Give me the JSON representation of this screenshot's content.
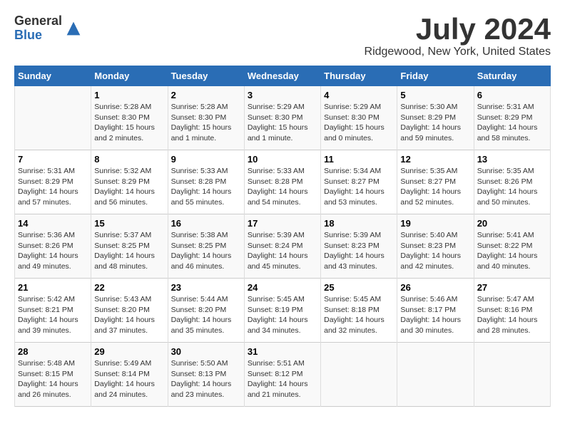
{
  "header": {
    "logo": {
      "general": "General",
      "blue": "Blue"
    },
    "title": "July 2024",
    "location": "Ridgewood, New York, United States"
  },
  "calendar": {
    "days_of_week": [
      "Sunday",
      "Monday",
      "Tuesday",
      "Wednesday",
      "Thursday",
      "Friday",
      "Saturday"
    ],
    "weeks": [
      [
        {
          "day": "",
          "info": ""
        },
        {
          "day": "1",
          "info": "Sunrise: 5:28 AM\nSunset: 8:30 PM\nDaylight: 15 hours\nand 2 minutes."
        },
        {
          "day": "2",
          "info": "Sunrise: 5:28 AM\nSunset: 8:30 PM\nDaylight: 15 hours\nand 1 minute."
        },
        {
          "day": "3",
          "info": "Sunrise: 5:29 AM\nSunset: 8:30 PM\nDaylight: 15 hours\nand 1 minute."
        },
        {
          "day": "4",
          "info": "Sunrise: 5:29 AM\nSunset: 8:30 PM\nDaylight: 15 hours\nand 0 minutes."
        },
        {
          "day": "5",
          "info": "Sunrise: 5:30 AM\nSunset: 8:29 PM\nDaylight: 14 hours\nand 59 minutes."
        },
        {
          "day": "6",
          "info": "Sunrise: 5:31 AM\nSunset: 8:29 PM\nDaylight: 14 hours\nand 58 minutes."
        }
      ],
      [
        {
          "day": "7",
          "info": "Sunrise: 5:31 AM\nSunset: 8:29 PM\nDaylight: 14 hours\nand 57 minutes."
        },
        {
          "day": "8",
          "info": "Sunrise: 5:32 AM\nSunset: 8:29 PM\nDaylight: 14 hours\nand 56 minutes."
        },
        {
          "day": "9",
          "info": "Sunrise: 5:33 AM\nSunset: 8:28 PM\nDaylight: 14 hours\nand 55 minutes."
        },
        {
          "day": "10",
          "info": "Sunrise: 5:33 AM\nSunset: 8:28 PM\nDaylight: 14 hours\nand 54 minutes."
        },
        {
          "day": "11",
          "info": "Sunrise: 5:34 AM\nSunset: 8:27 PM\nDaylight: 14 hours\nand 53 minutes."
        },
        {
          "day": "12",
          "info": "Sunrise: 5:35 AM\nSunset: 8:27 PM\nDaylight: 14 hours\nand 52 minutes."
        },
        {
          "day": "13",
          "info": "Sunrise: 5:35 AM\nSunset: 8:26 PM\nDaylight: 14 hours\nand 50 minutes."
        }
      ],
      [
        {
          "day": "14",
          "info": "Sunrise: 5:36 AM\nSunset: 8:26 PM\nDaylight: 14 hours\nand 49 minutes."
        },
        {
          "day": "15",
          "info": "Sunrise: 5:37 AM\nSunset: 8:25 PM\nDaylight: 14 hours\nand 48 minutes."
        },
        {
          "day": "16",
          "info": "Sunrise: 5:38 AM\nSunset: 8:25 PM\nDaylight: 14 hours\nand 46 minutes."
        },
        {
          "day": "17",
          "info": "Sunrise: 5:39 AM\nSunset: 8:24 PM\nDaylight: 14 hours\nand 45 minutes."
        },
        {
          "day": "18",
          "info": "Sunrise: 5:39 AM\nSunset: 8:23 PM\nDaylight: 14 hours\nand 43 minutes."
        },
        {
          "day": "19",
          "info": "Sunrise: 5:40 AM\nSunset: 8:23 PM\nDaylight: 14 hours\nand 42 minutes."
        },
        {
          "day": "20",
          "info": "Sunrise: 5:41 AM\nSunset: 8:22 PM\nDaylight: 14 hours\nand 40 minutes."
        }
      ],
      [
        {
          "day": "21",
          "info": "Sunrise: 5:42 AM\nSunset: 8:21 PM\nDaylight: 14 hours\nand 39 minutes."
        },
        {
          "day": "22",
          "info": "Sunrise: 5:43 AM\nSunset: 8:20 PM\nDaylight: 14 hours\nand 37 minutes."
        },
        {
          "day": "23",
          "info": "Sunrise: 5:44 AM\nSunset: 8:20 PM\nDaylight: 14 hours\nand 35 minutes."
        },
        {
          "day": "24",
          "info": "Sunrise: 5:45 AM\nSunset: 8:19 PM\nDaylight: 14 hours\nand 34 minutes."
        },
        {
          "day": "25",
          "info": "Sunrise: 5:45 AM\nSunset: 8:18 PM\nDaylight: 14 hours\nand 32 minutes."
        },
        {
          "day": "26",
          "info": "Sunrise: 5:46 AM\nSunset: 8:17 PM\nDaylight: 14 hours\nand 30 minutes."
        },
        {
          "day": "27",
          "info": "Sunrise: 5:47 AM\nSunset: 8:16 PM\nDaylight: 14 hours\nand 28 minutes."
        }
      ],
      [
        {
          "day": "28",
          "info": "Sunrise: 5:48 AM\nSunset: 8:15 PM\nDaylight: 14 hours\nand 26 minutes."
        },
        {
          "day": "29",
          "info": "Sunrise: 5:49 AM\nSunset: 8:14 PM\nDaylight: 14 hours\nand 24 minutes."
        },
        {
          "day": "30",
          "info": "Sunrise: 5:50 AM\nSunset: 8:13 PM\nDaylight: 14 hours\nand 23 minutes."
        },
        {
          "day": "31",
          "info": "Sunrise: 5:51 AM\nSunset: 8:12 PM\nDaylight: 14 hours\nand 21 minutes."
        },
        {
          "day": "",
          "info": ""
        },
        {
          "day": "",
          "info": ""
        },
        {
          "day": "",
          "info": ""
        }
      ]
    ]
  }
}
